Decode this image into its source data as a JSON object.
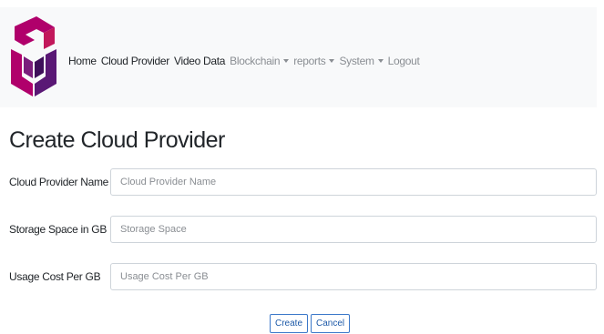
{
  "navbar": {
    "logo": "cube-logo-icon",
    "items": [
      {
        "label": "Home",
        "style": "active",
        "dropdown": false
      },
      {
        "label": "Cloud Provider",
        "style": "active",
        "dropdown": false
      },
      {
        "label": "Video Data",
        "style": "active",
        "dropdown": false
      },
      {
        "label": "Blockchain",
        "style": "muted",
        "dropdown": true
      },
      {
        "label": "reports",
        "style": "muted",
        "dropdown": true
      },
      {
        "label": "System",
        "style": "muted",
        "dropdown": true
      },
      {
        "label": "Logout",
        "style": "muted",
        "dropdown": false
      }
    ]
  },
  "page": {
    "title": "Create Cloud Provider"
  },
  "form": {
    "fields": [
      {
        "label": "Cloud Provider Name",
        "placeholder": "Cloud Provider Name",
        "value": ""
      },
      {
        "label": "Storage Space in GB",
        "placeholder": "Storage Space",
        "value": ""
      },
      {
        "label": "Usage Cost Per GB",
        "placeholder": "Usage Cost Per GB",
        "value": ""
      }
    ],
    "create_label": "Create",
    "cancel_label": "Cancel"
  },
  "colors": {
    "navbar_bg": "#f8f9fa",
    "logo_primary": "#b0006b",
    "logo_secondary": "#4a1466",
    "button_border": "#3b78c9"
  }
}
